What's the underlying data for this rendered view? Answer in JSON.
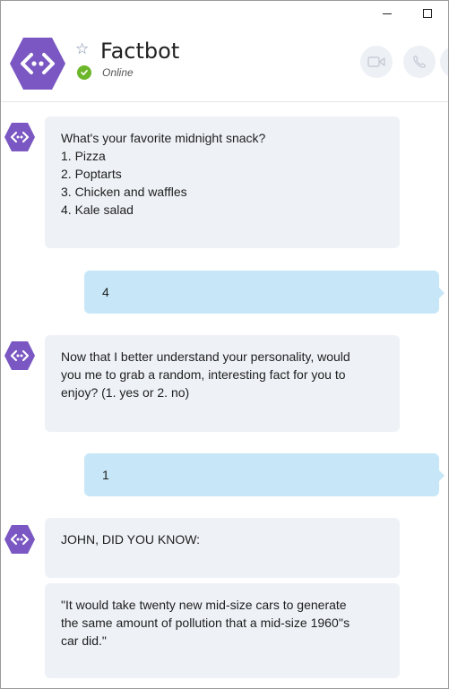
{
  "window": {
    "minimize_icon": "minimize-icon",
    "maximize_icon": "maximize-icon"
  },
  "header": {
    "bot_name": "Factbot",
    "status": "Online",
    "status_color": "#6cb62a",
    "brand_color": "#7a57c2",
    "favorite_icon": "star-outline-icon",
    "video_call_icon": "video-camera-icon",
    "voice_call_icon": "phone-icon"
  },
  "messages": [
    {
      "from": "bot",
      "lines": [
        "What's your favorite midnight snack?",
        "1. Pizza",
        "2. Poptarts",
        "3. Chicken and waffles",
        "4. Kale salad"
      ]
    },
    {
      "from": "user",
      "lines": [
        "4"
      ]
    },
    {
      "from": "bot",
      "lines": [
        "Now that I better understand your personality, would",
        "you me to grab a random, interesting fact for you to",
        "enjoy? (1. yes or 2. no)"
      ]
    },
    {
      "from": "user",
      "lines": [
        "1"
      ]
    },
    {
      "from": "bot",
      "lines": [
        "JOHN, DID YOU KNOW:"
      ]
    },
    {
      "from": "bot",
      "lines": [
        "\"It would take twenty new mid-size cars to generate",
        "the same amount of pollution that a mid-size 1960''s",
        "car did.\""
      ]
    }
  ]
}
